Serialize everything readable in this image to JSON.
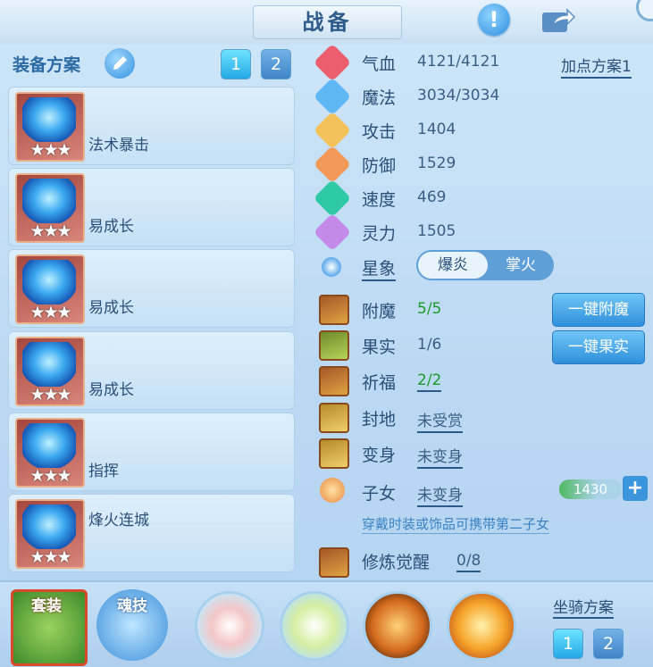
{
  "header": {
    "title": "战备"
  },
  "left": {
    "plan_label": "装备方案",
    "plan_buttons": [
      "1",
      "2"
    ],
    "equipment": [
      {
        "label": "法术暴击",
        "stars": "★★★"
      },
      {
        "label": "易成长",
        "stars": "★★★"
      },
      {
        "label": "易成长",
        "stars": "★★★"
      },
      {
        "label": "易成长",
        "stars": "★★★"
      },
      {
        "label": "指挥",
        "stars": "★★★"
      },
      {
        "label": "烽火连城",
        "stars": "★★★"
      }
    ]
  },
  "stats": {
    "addpoint_label": "加点方案1",
    "items": [
      {
        "name": "气血",
        "value": "4121/4121",
        "icon": "heart-icon",
        "color": "#ec5d6d"
      },
      {
        "name": "魔法",
        "value": "3034/3034",
        "icon": "mana-icon",
        "color": "#5fb8f3"
      },
      {
        "name": "攻击",
        "value": "1404",
        "icon": "sword-icon",
        "color": "#f3c25a"
      },
      {
        "name": "防御",
        "value": "1529",
        "icon": "shield-icon",
        "color": "#f29a5a"
      },
      {
        "name": "速度",
        "value": "469",
        "icon": "speed-icon",
        "color": "#2fc9a5"
      },
      {
        "name": "灵力",
        "value": "1505",
        "icon": "spirit-icon",
        "color": "#c48ae8"
      }
    ],
    "star_label": "星象",
    "star_options": [
      "爆炎",
      "掌火"
    ]
  },
  "bonuses": {
    "enchant": {
      "name": "附魔",
      "value": "5/5",
      "button": "一键附魔"
    },
    "fruit": {
      "name": "果实",
      "value": "1/6",
      "button": "一键果实"
    },
    "blessing": {
      "name": "祈福",
      "value": "2/2"
    },
    "fief": {
      "name": "封地",
      "value": "未受赏"
    },
    "transform": {
      "name": "变身",
      "value": "未变身"
    },
    "child": {
      "name": "子女",
      "value": "未变身",
      "bar_value": "1430",
      "plus": "+"
    },
    "hint": "穿戴时装或饰品可携带第二子女",
    "awaken": {
      "name": "修炼觉醒",
      "value": "0/8"
    }
  },
  "bottom": {
    "tabs": [
      "套装",
      "魂技"
    ],
    "mount_label": "坐骑方案",
    "mount_buttons": [
      "1",
      "2"
    ]
  }
}
